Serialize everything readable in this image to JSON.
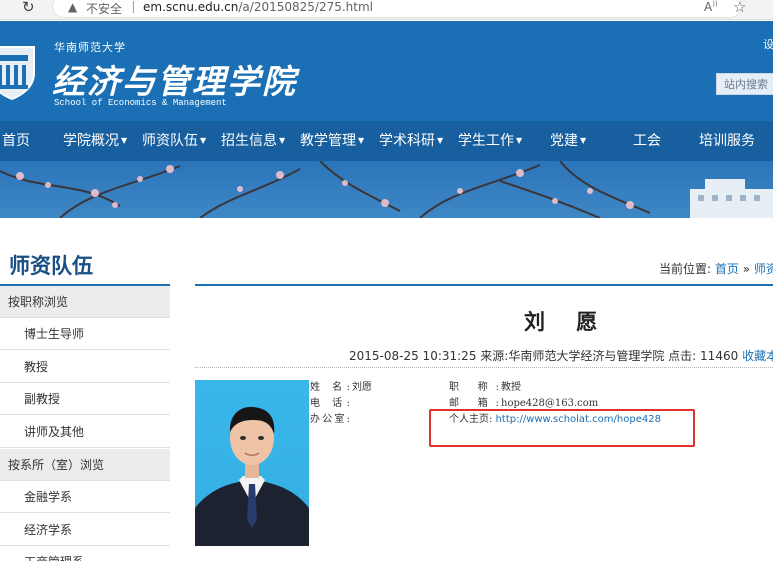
{
  "browser": {
    "security_label": "不安全",
    "url_host": "em.scnu.edu.cn",
    "url_path": "/a/20150825/275.html"
  },
  "header": {
    "university_name": "华南师范大学",
    "college_name_cn": "经济与管理学院",
    "college_name_en": "School of Economics & Management",
    "top_link": "设",
    "search_label": "站内搜索"
  },
  "nav": {
    "items": [
      {
        "label": "首页",
        "caret": ""
      },
      {
        "label": "学院概况",
        "caret": "▼"
      },
      {
        "label": "师资队伍",
        "caret": "▼"
      },
      {
        "label": "招生信息",
        "caret": "▼"
      },
      {
        "label": "教学管理",
        "caret": "▼"
      },
      {
        "label": "学术科研",
        "caret": "▼"
      },
      {
        "label": "学生工作",
        "caret": "▼"
      },
      {
        "label": "党建",
        "caret": "▼"
      },
      {
        "label": "工会",
        "caret": ""
      },
      {
        "label": "培训服务",
        "caret": ""
      }
    ]
  },
  "sidebar": {
    "title": "师资队伍",
    "items": [
      {
        "label": "按职称浏览",
        "type": "group"
      },
      {
        "label": "博士生导师",
        "type": "sub"
      },
      {
        "label": "教授",
        "type": "sub"
      },
      {
        "label": "副教授",
        "type": "sub"
      },
      {
        "label": "讲师及其他",
        "type": "sub"
      },
      {
        "label": "按系所（室）浏览",
        "type": "group"
      },
      {
        "label": "金融学系",
        "type": "sub"
      },
      {
        "label": "经济学系",
        "type": "sub"
      },
      {
        "label": "工商管理系",
        "type": "sub"
      }
    ]
  },
  "breadcrumb": {
    "prefix": "当前位置:",
    "home": "首页",
    "sep": "»",
    "current": "师资"
  },
  "article": {
    "title": "刘 愿",
    "date": "2015-08-25 10:31:25",
    "source_label": "来源:",
    "source": "华南师范大学经济与管理学院",
    "clicks_label": "点击:",
    "clicks": "11460",
    "favorite": "收藏本文"
  },
  "profile": {
    "name_label": "姓 名:",
    "name_value": "刘愿",
    "phone_label": "电 话:",
    "phone_value": "",
    "office_label": "办公室:",
    "office_value": "",
    "title_label": "职 称:",
    "title_value": "教授",
    "email_label": "邮 箱:",
    "email_value": "hope428@163.com",
    "homepage_label": "个人主页:",
    "homepage_value": "http://www.scholat.com/hope428"
  },
  "colors": {
    "header_blue": "#1a6fb5",
    "nav_blue": "#175f9f",
    "link_blue": "#1a6fb5",
    "highlight_red": "#e0312c"
  }
}
